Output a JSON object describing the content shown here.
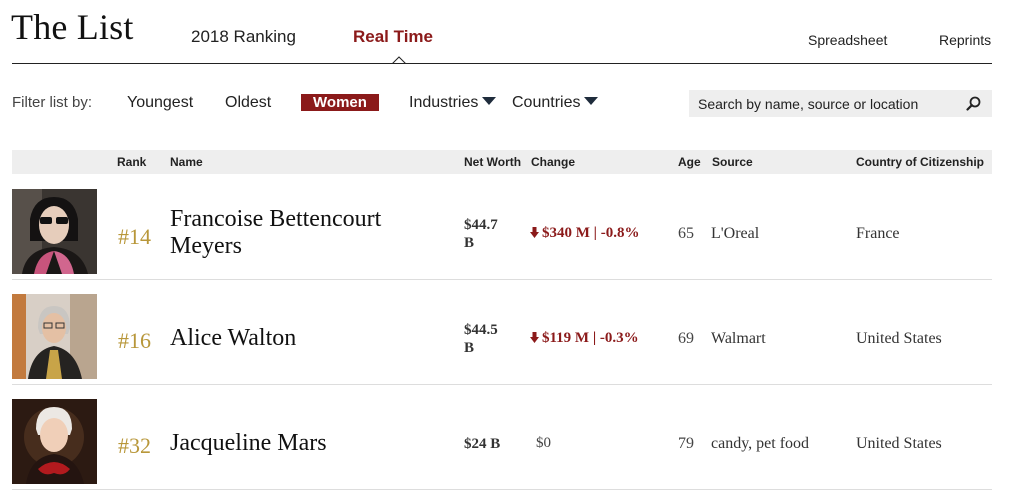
{
  "header": {
    "title": "The List",
    "tabs": [
      {
        "label": "2018 Ranking",
        "active": false
      },
      {
        "label": "Real Time",
        "active": true
      }
    ],
    "links": [
      "Spreadsheet",
      "Reprints"
    ],
    "accent_color": "#8b1a1a"
  },
  "filters": {
    "label": "Filter list by:",
    "options": [
      {
        "label": "Youngest"
      },
      {
        "label": "Oldest"
      },
      {
        "label": "Women",
        "active": true
      },
      {
        "label": "Industries",
        "icon": "caret-down-icon"
      },
      {
        "label": "Countries",
        "icon": "caret-down-icon"
      }
    ]
  },
  "search": {
    "placeholder": "Search by name, source or location",
    "value": "",
    "icon": "search-icon"
  },
  "table": {
    "columns": [
      "Rank",
      "Name",
      "Net Worth",
      "Change",
      "Age",
      "Source",
      "Country of Citizenship"
    ],
    "rows": [
      {
        "rank": "#14",
        "name_line1": "Francoise Bettencourt",
        "name_line2": "Meyers",
        "worth_line1": "$44.7",
        "worth_line2": "B",
        "change": "$340 M | -0.8%",
        "change_direction": "down",
        "age": "65",
        "source": "L'Oreal",
        "country": "France"
      },
      {
        "rank": "#16",
        "name_line1": "Alice Walton",
        "worth_line1": "$44.5",
        "worth_line2": "B",
        "change": "$119 M | -0.3%",
        "change_direction": "down",
        "age": "69",
        "source": "Walmart",
        "country": "United States"
      },
      {
        "rank": "#32",
        "name_line1": "Jacqueline Mars",
        "worth_line1": "$24 B",
        "change": "$0",
        "change_direction": "none",
        "age": "79",
        "source": "candy, pet food",
        "country": "United States"
      }
    ]
  }
}
